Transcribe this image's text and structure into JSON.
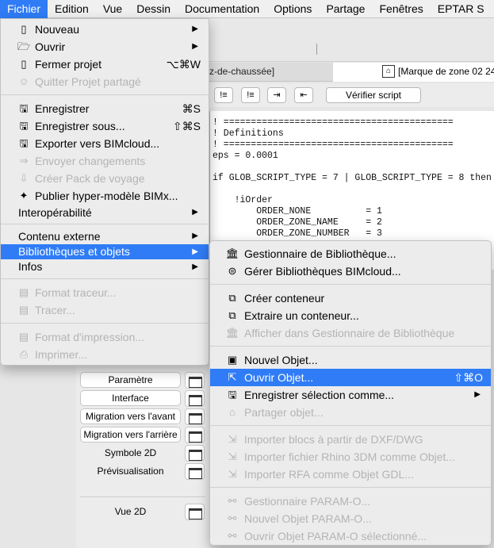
{
  "menubar": [
    "Fichier",
    "Edition",
    "Vue",
    "Dessin",
    "Documentation",
    "Options",
    "Partage",
    "Fenêtres",
    "EPTAR S"
  ],
  "tabs": {
    "left": "z-de-chaussée]",
    "right": "[Marque de zone 02 24"
  },
  "toolbar": {
    "verify": "Vérifier script",
    "b1": "!≡",
    "b2": "!≡",
    "b3": "⇥",
    "b4": "⇤"
  },
  "code": [
    "! ==========================================",
    "! Definitions",
    "! ==========================================",
    "eps = 0.0001",
    "",
    "if GLOB_SCRIPT_TYPE = 7 | GLOB_SCRIPT_TYPE = 8 then",
    "",
    "    !iOrder",
    "        ORDER_NONE          = 1",
    "        ORDER_ZONE_NAME     = 2",
    "        ORDER_ZONE_NUMBER   = 3"
  ],
  "panel": {
    "param": "Paramètre",
    "interface": "Interface",
    "fwd": "Migration vers l'avant",
    "back": "Migration vers l'arrière",
    "sym": "Symbole 2D",
    "preview": "Prévisualisation",
    "view2d": "Vue 2D"
  },
  "file_menu": {
    "nouveau": "Nouveau",
    "ouvrir": "Ouvrir",
    "fermer": "Fermer projet",
    "fermer_sc": "⌥⌘W",
    "quitter": "Quitter Projet partagé",
    "enregistrer": "Enregistrer",
    "enregistrer_sc": "⌘S",
    "enregistrer_sous": "Enregistrer sous...",
    "enregistrer_sous_sc": "⇧⌘S",
    "exporter": "Exporter vers BIMcloud...",
    "envoyer": "Envoyer changements",
    "pack": "Créer Pack de voyage",
    "publier": "Publier hyper-modèle BIMx...",
    "interop": "Interopérabilité",
    "contenu": "Contenu externe",
    "biblio": "Bibliothèques et objets",
    "infos": "Infos",
    "format_traceur": "Format traceur...",
    "tracer": "Tracer...",
    "format_impr": "Format d'impression...",
    "imprimer": "Imprimer..."
  },
  "sub_menu": {
    "gest": "Gestionnaire de Bibliothèque...",
    "gerer": "Gérer Bibliothèques BIMcloud...",
    "creer_cont": "Créer conteneur",
    "extraire": "Extraire un conteneur...",
    "afficher": "Afficher dans Gestionnaire de Bibliothèque",
    "nouvel": "Nouvel Objet...",
    "ouvrir": "Ouvrir Objet...",
    "ouvrir_sc": "⇧⌘O",
    "enreg_sel": "Enregistrer sélection comme...",
    "partager": "Partager objet...",
    "imp_dxf": "Importer blocs à partir de DXF/DWG",
    "imp_rhino": "Importer fichier Rhino 3DM comme Objet...",
    "imp_rfa": "Importer RFA comme Objet GDL...",
    "param_gest": "Gestionnaire PARAM-O...",
    "param_new": "Nouvel Objet PARAM-O...",
    "param_open": "Ouvrir Objet PARAM-O sélectionné..."
  },
  "colors": {
    "highlight": "#2f7cf6"
  }
}
